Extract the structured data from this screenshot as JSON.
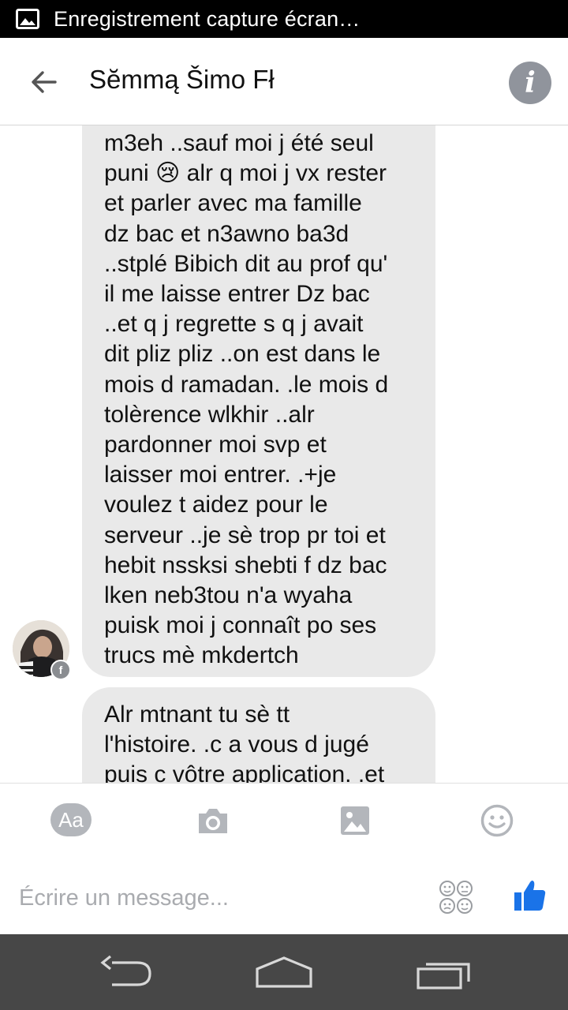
{
  "status_bar": {
    "notification_text": "Enregistrement capture écran…"
  },
  "header": {
    "title": "Sĕmmą Šimo Fł"
  },
  "messages": [
    {
      "lines": [
        "m3eh ..sauf moi j été seul",
        "puni 😢 alr q moi j vx rester",
        "et parler avec ma famille",
        "dz bac et n3awno ba3d",
        "..stplé Bibich dit au prof qu'",
        "il me laisse entrer Dz bac",
        "..et q j regrette s q j avait",
        "dit pliz pliz ..on est dans le",
        "mois d ramadan. .le mois d",
        "tolèrence wlkhir ..alr",
        "pardonner moi svp et",
        "laisser moi entrer. .+je",
        "voulez t aidez pour le",
        "serveur ..je sè  trop pr toi et",
        "hebit nssksi shebti f dz bac",
        "lken neb3tou n'a wyaha",
        "puisk moi j connaît po ses",
        "trucs mè mkdertch"
      ]
    },
    {
      "lines": [
        "Alr mtnant tu sè tt",
        "l'histoire. .c a vous d jugé",
        "puis c vôtre application. .et"
      ]
    }
  ],
  "composer": {
    "aa_label": "Aa",
    "placeholder": "Écrire un message..."
  },
  "colors": {
    "bubble": "#e9e9e9",
    "like_blue": "#1a73e8",
    "icon_gray": "#b3b6bb",
    "nav_bar": "#474747"
  }
}
